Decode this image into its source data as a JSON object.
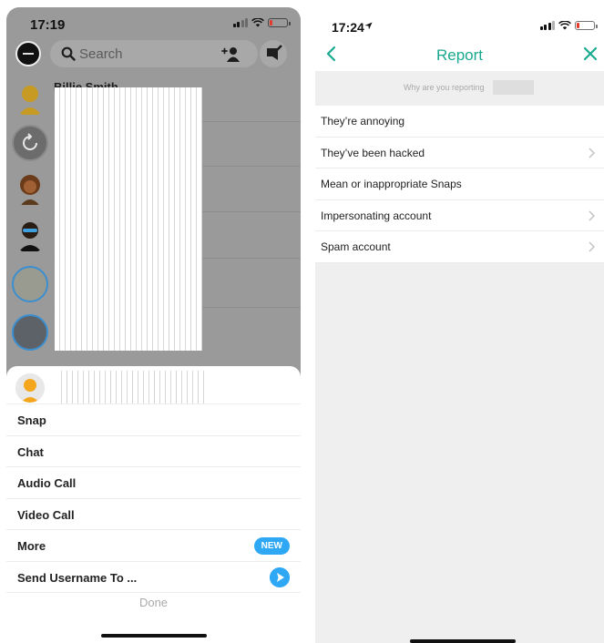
{
  "left": {
    "status": {
      "time": "17:19"
    },
    "search": {
      "placeholder": "Search"
    },
    "chats": [
      {
        "name": "Billie Smith"
      }
    ],
    "sheet": {
      "items": [
        {
          "label": "Snap"
        },
        {
          "label": "Chat"
        },
        {
          "label": "Audio Call"
        },
        {
          "label": "Video Call"
        },
        {
          "label": "More",
          "badge": "NEW"
        },
        {
          "label": "Send Username To ..."
        }
      ],
      "done_label": "Done"
    }
  },
  "right": {
    "status": {
      "time": "17:24"
    },
    "title": "Report",
    "why_label": "Why are you reporting",
    "reasons": [
      {
        "label": "They’re annoying",
        "has_chevron": false
      },
      {
        "label": "They’ve been hacked",
        "has_chevron": true
      },
      {
        "label": "Mean or inappropriate Snaps",
        "has_chevron": false
      },
      {
        "label": "Impersonating account",
        "has_chevron": true
      },
      {
        "label": "Spam account",
        "has_chevron": true
      }
    ]
  },
  "colors": {
    "accent_teal": "#19a98e",
    "badge_blue": "#2ea7f5",
    "dim_overlay": "#9a9a9a"
  },
  "icons": [
    "search-icon",
    "add-friend-icon",
    "new-chat-icon",
    "location-arrow-icon",
    "back-chevron-icon",
    "close-icon",
    "chevron-right-icon",
    "send-arrow-icon",
    "signal-icon",
    "wifi-icon",
    "battery-icon"
  ]
}
